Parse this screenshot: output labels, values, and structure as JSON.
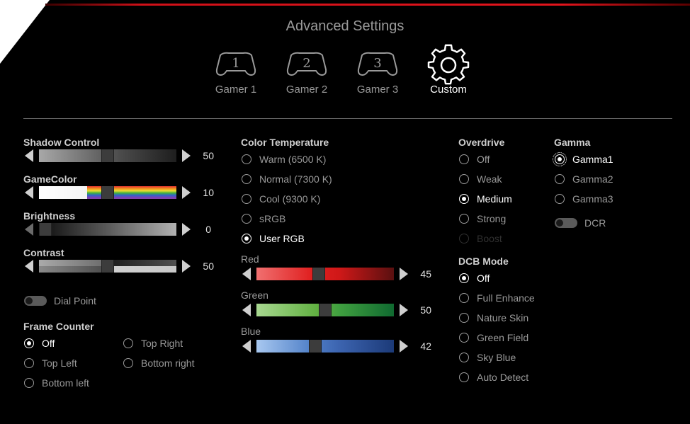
{
  "title": "Advanced Settings",
  "presets": [
    {
      "label": "Gamer 1",
      "number": "1",
      "icon": "gamepad-icon"
    },
    {
      "label": "Gamer 2",
      "number": "2",
      "icon": "gamepad-icon"
    },
    {
      "label": "Gamer 3",
      "number": "3",
      "icon": "gamepad-icon"
    },
    {
      "label": "Custom",
      "icon": "gear-icon",
      "active": true
    }
  ],
  "sliders": {
    "shadow_control": {
      "label": "Shadow Control",
      "value": "50"
    },
    "gamecolor": {
      "label": "GameColor",
      "value": "10"
    },
    "brightness": {
      "label": "Brightness",
      "value": "0"
    },
    "contrast": {
      "label": "Contrast",
      "value": "50"
    }
  },
  "dial_point": {
    "label": "Dial Point",
    "on": false
  },
  "frame_counter": {
    "label": "Frame Counter",
    "options": [
      "Off",
      "Top Right",
      "Top Left",
      "Bottom right",
      "Bottom left"
    ],
    "selected": "Off"
  },
  "color_temperature": {
    "label": "Color Temperature",
    "options": [
      "Warm (6500 K)",
      "Normal (7300 K)",
      "Cool (9300 K)",
      "sRGB",
      "User RGB"
    ],
    "selected": "User RGB"
  },
  "rgb": {
    "red": {
      "label": "Red",
      "value": "45"
    },
    "green": {
      "label": "Green",
      "value": "50"
    },
    "blue": {
      "label": "Blue",
      "value": "42"
    }
  },
  "overdrive": {
    "label": "Overdrive",
    "options": [
      "Off",
      "Weak",
      "Medium",
      "Strong",
      "Boost"
    ],
    "selected": "Medium",
    "disabled": [
      "Boost"
    ]
  },
  "dcb_mode": {
    "label": "DCB Mode",
    "options": [
      "Off",
      "Full Enhance",
      "Nature Skin",
      "Green Field",
      "Sky Blue",
      "Auto Detect"
    ],
    "selected": "Off"
  },
  "gamma": {
    "label": "Gamma",
    "options": [
      "Gamma1",
      "Gamma2",
      "Gamma3"
    ],
    "selected": "Gamma1"
  },
  "dcr": {
    "label": "DCR",
    "on": false
  },
  "colors": {
    "accent_red": "#e2141c",
    "background": "#000000",
    "text": "#9a9a9a",
    "selected_text": "#ffffff"
  }
}
